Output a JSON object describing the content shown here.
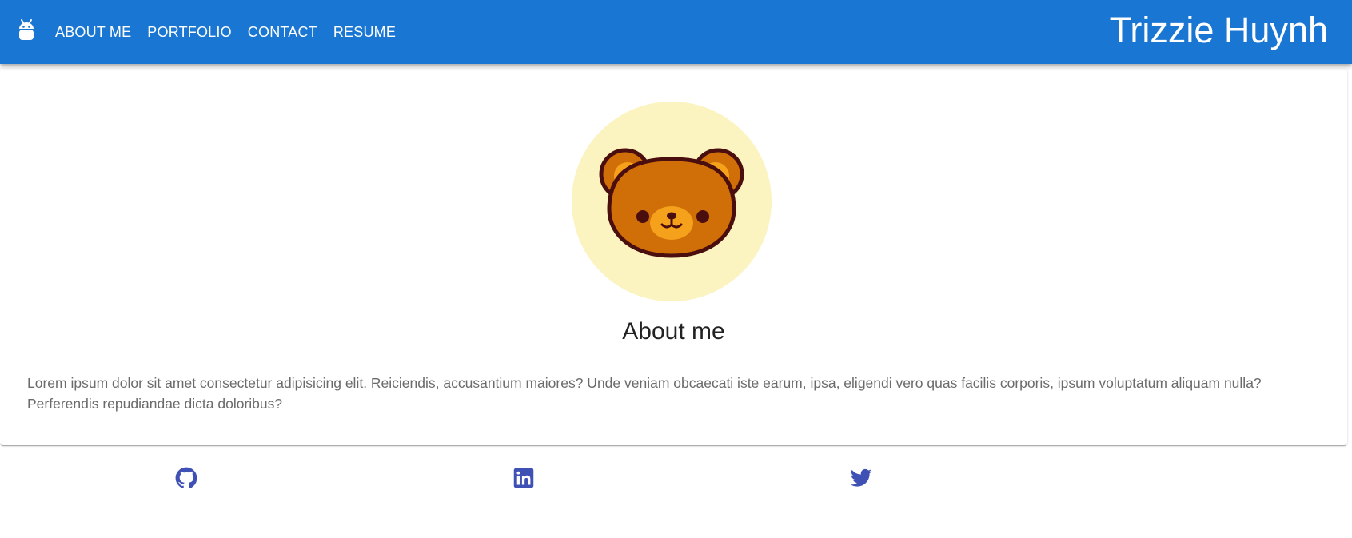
{
  "header": {
    "logo_icon": "android-icon",
    "nav": [
      {
        "label": "ABOUT ME"
      },
      {
        "label": "PORTFOLIO"
      },
      {
        "label": "CONTACT"
      },
      {
        "label": "RESUME"
      }
    ],
    "brand_name": "Trizzie Huynh",
    "background_color": "#1976d2"
  },
  "about": {
    "avatar_icon": "bear-face-icon",
    "title": "About me",
    "text": "Lorem ipsum dolor sit amet consectetur adipisicing elit. Reiciendis, accusantium maiores? Unde veniam obcaecati iste earum, ipsa, eligendi vero quas facilis corporis, ipsum voluptatum aliquam nulla? Perferendis repudiandae dicta doloribus?"
  },
  "footer": {
    "social_links": [
      {
        "icon": "github-icon"
      },
      {
        "icon": "linkedin-icon"
      },
      {
        "icon": "twitter-icon"
      }
    ],
    "icon_color": "#3f51b5"
  }
}
